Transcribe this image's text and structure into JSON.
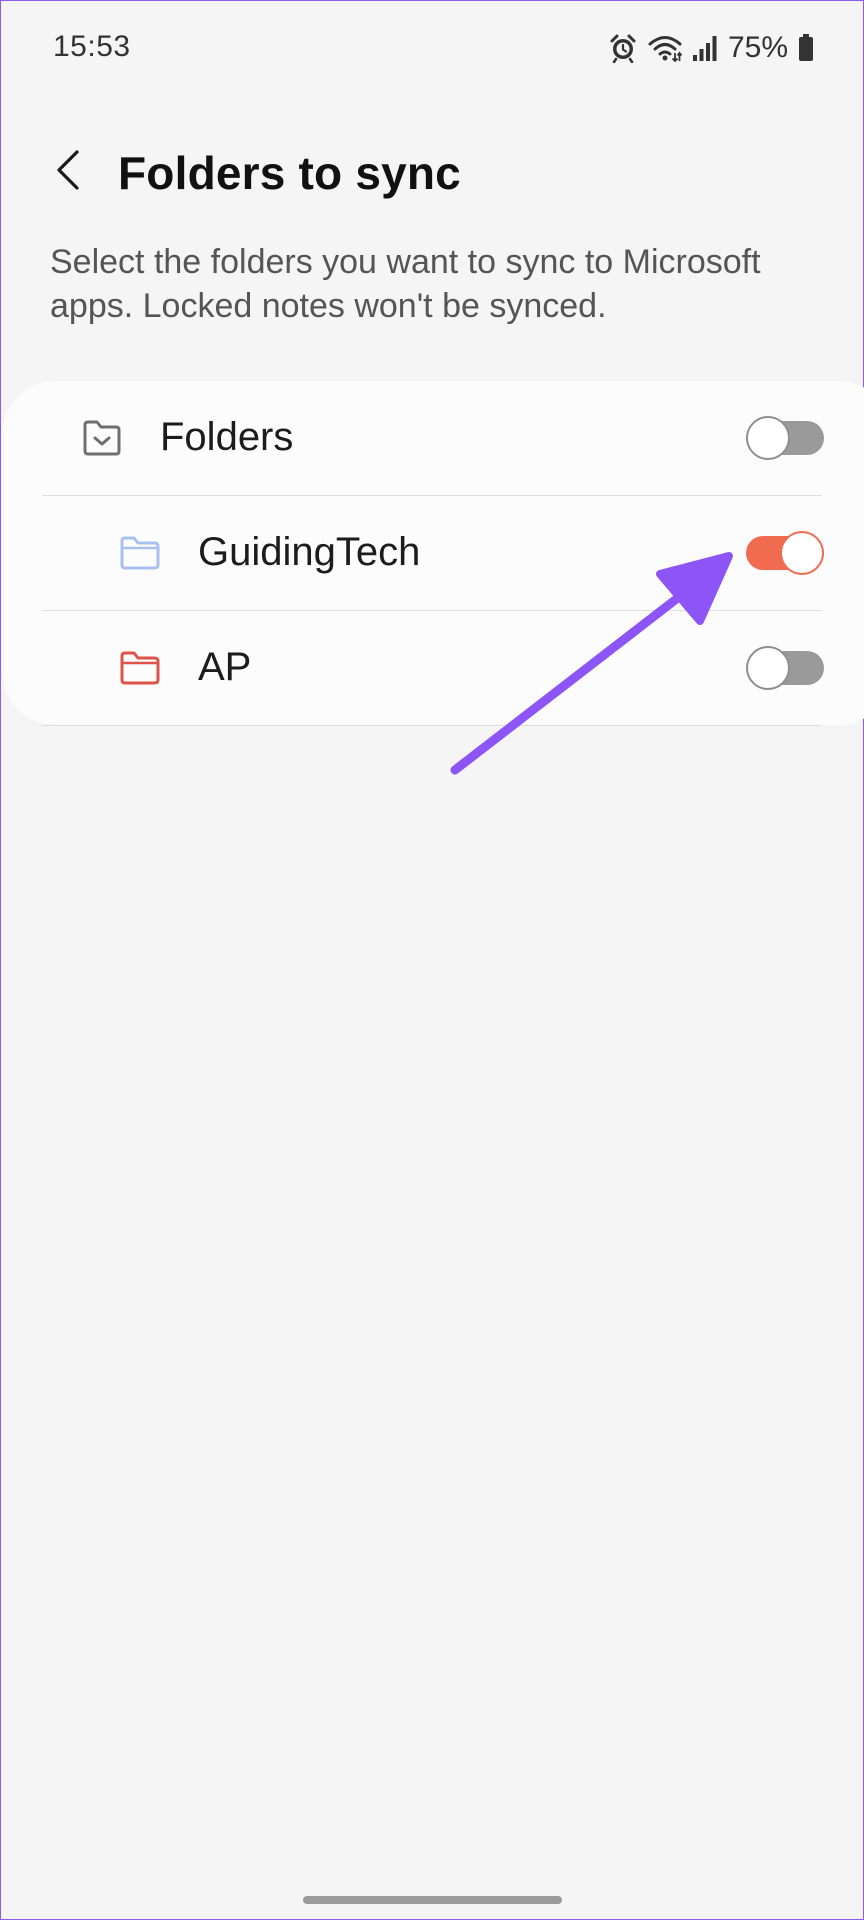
{
  "status_bar": {
    "time": "15:53",
    "battery_percent": "75%",
    "icons": [
      "alarm-icon",
      "wifi-icon",
      "signal-icon",
      "battery-icon"
    ]
  },
  "header": {
    "title": "Folders to sync",
    "back_icon": "chevron-left-icon"
  },
  "description": "Select the folders you want to sync to Microsoft apps. Locked notes won't be synced.",
  "folders": [
    {
      "label": "Folders",
      "icon": "folder-check-icon",
      "icon_color": "#6f6f6f",
      "sync_enabled": false
    },
    {
      "label": "GuidingTech",
      "icon": "folder-icon",
      "icon_color": "#a9c1f2",
      "sync_enabled": true
    },
    {
      "label": "AP",
      "icon": "folder-icon",
      "icon_color": "#dd5448",
      "sync_enabled": false
    }
  ],
  "colors": {
    "toggle_on": "#f16b50",
    "toggle_off": "#9a9a9a",
    "annotation_arrow": "#8d55f6",
    "background": "#f5f5f6"
  }
}
